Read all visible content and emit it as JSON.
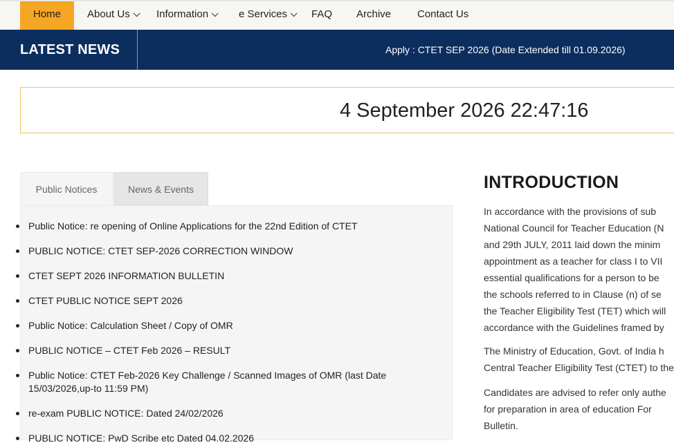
{
  "nav": {
    "home": "Home",
    "about": "About Us",
    "information": "Information",
    "eservices": "e Services",
    "faq": "FAQ",
    "archive": "Archive",
    "contact": "Contact Us"
  },
  "news": {
    "title": "LATEST NEWS",
    "ticker": "Apply : CTET SEP 2026 (Date Extended till 01.09.2026)"
  },
  "clock": {
    "datetime": "4 September 2026 22:47:16"
  },
  "tabs": [
    {
      "label": "Public Notices"
    },
    {
      "label": "News & Events"
    }
  ],
  "notices": [
    "Public Notice: re opening of Online Applications for the 22nd Edition of CTET",
    "PUBLIC NOTICE: CTET SEP-2026 CORRECTION WINDOW",
    "CTET SEPT 2026 INFORMATION BULLETIN",
    "CTET PUBLIC NOTICE SEPT 2026",
    "Public Notice: Calculation Sheet / Copy of OMR",
    "PUBLIC NOTICE – CTET Feb 2026 – RESULT",
    "Public Notice: CTET Feb-2026 Key Challenge / Scanned Images of OMR (last Date",
    "15/03/2026,up-to 11:59 PM)",
    "re-exam PUBLIC NOTICE: Dated 24/02/2026",
    "PUBLIC NOTICE: PwD Scribe etc Dated 04.02.2026"
  ],
  "intro": {
    "title": "INTRODUCTION",
    "para1": [
      "In accordance with the provisions of sub",
      "National Council for Teacher Education (N",
      "and 29th JULY, 2011 laid down the minim",
      "appointment as a teacher for class I to VII",
      "essential qualifications for a person to be",
      "the schools referred to in Clause (n) of se",
      "the Teacher Eligibility Test (TET) which will",
      "accordance with the Guidelines framed by"
    ],
    "para2": [
      "The Ministry of Education, Govt. of India h",
      "Central Teacher Eligibility Test (CTET) to the"
    ],
    "para3": [
      "Candidates are advised to refer only authe",
      "for preparation in area of education For",
      "Bulletin."
    ]
  }
}
